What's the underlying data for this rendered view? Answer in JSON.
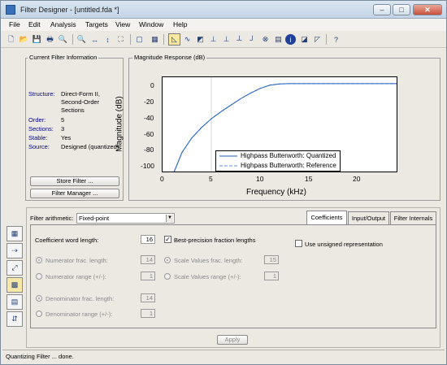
{
  "window": {
    "title": "Filter Designer - [untitled.fda *]",
    "min": "–",
    "max": "□",
    "close": "✕"
  },
  "menu": [
    "File",
    "Edit",
    "Analysis",
    "Targets",
    "View",
    "Window",
    "Help"
  ],
  "toolbar": {
    "items": [
      "new-icon",
      "open-icon",
      "save-icon",
      "print-icon",
      "print-preview-icon",
      "zoom-in-icon",
      "zoom-x-icon",
      "zoom-y-icon",
      "full-view-icon",
      "new-figure-icon",
      "grid-icon",
      "magnitude-response-icon",
      "phase-response-icon",
      "magnitude-phase-icon",
      "group-delay-icon",
      "phase-delay-icon",
      "impulse-response-icon",
      "step-response-icon",
      "pole-zero-icon",
      "coefficients-icon",
      "info-icon",
      "magnitude-estimate-icon",
      "noise-power-icon",
      "whats-this-icon"
    ],
    "glyphs": [
      "🗋",
      "📂",
      "💾",
      "🖶",
      "🔍",
      "🔍",
      "↔",
      "↕",
      "⛶",
      "▢",
      "▦",
      "◺",
      "∿",
      "◩",
      "⊥",
      "⊥",
      "┴",
      "┘",
      "⊗",
      "▤",
      "i",
      "◪",
      "◸",
      "?"
    ]
  },
  "current_filter": {
    "title": "Current Filter Information",
    "rows": [
      {
        "label": "Structure:",
        "value": "Direct-Form II,"
      },
      {
        "label": "",
        "value": "Second-Order"
      },
      {
        "label": "",
        "value": "Sections"
      },
      {
        "label": "Order:",
        "value": "5"
      },
      {
        "label": "Sections:",
        "value": "3"
      },
      {
        "label": "Stable:",
        "value": "Yes"
      },
      {
        "label": "Source:",
        "value": "Designed (quantized)"
      }
    ],
    "store_button": "Store Filter ...",
    "manager_button": "Filter Manager ..."
  },
  "magnitude": {
    "title": "Magnitude Response (dB)",
    "ylabel": "Magnitude (dB)",
    "xlabel": "Frequency (kHz)",
    "yticks": [
      "0",
      "-20",
      "-40",
      "-60",
      "-80",
      "-100"
    ],
    "xticks": [
      "0",
      "5",
      "10",
      "15",
      "20"
    ],
    "legend": [
      "Highpass Butterworth: Quantized",
      "Highpass Butterworth: Reference"
    ]
  },
  "chart_data": {
    "type": "line",
    "title": "Magnitude Response (dB)",
    "xlabel": "Frequency (kHz)",
    "ylabel": "Magnitude (dB)",
    "xlim": [
      0,
      24
    ],
    "ylim": [
      -110,
      8
    ],
    "series": [
      {
        "name": "Highpass Butterworth: Quantized",
        "x": [
          1.2,
          2,
          3,
          4,
          5,
          6,
          7,
          8,
          9,
          10,
          11,
          12,
          13,
          16,
          20,
          24
        ],
        "y": [
          -110,
          -86,
          -68,
          -55,
          -44,
          -35,
          -27,
          -19,
          -12,
          -6,
          -2,
          -0.3,
          0,
          0,
          0,
          0
        ]
      },
      {
        "name": "Highpass Butterworth: Reference",
        "x": [
          1.2,
          2,
          3,
          4,
          5,
          6,
          7,
          8,
          9,
          10,
          11,
          12,
          13,
          16,
          20,
          24
        ],
        "y": [
          -110,
          -86,
          -68,
          -55,
          -44,
          -35,
          -27,
          -19,
          -12,
          -6,
          -2,
          -0.3,
          0,
          0,
          0,
          0
        ]
      }
    ]
  },
  "quant": {
    "arith_label": "Filter arithmetic:",
    "arith_value": "Fixed-point",
    "tabs": [
      "Coefficients",
      "Input/Output",
      "Filter Internals"
    ],
    "coef_word_label": "Coefficient word length:",
    "coef_word_value": "16",
    "best_precision": "Best-precision fraction lengths",
    "unsigned": "Use unsigned representation",
    "num_frac_label": "Numerator frac. length:",
    "num_frac_value": "14",
    "num_range_label": "Numerator range (+/-):",
    "num_range_value": "1",
    "sv_frac_label": "Scale Values frac. length:",
    "sv_frac_value": "15",
    "sv_range_label": "Scale Values range (+/-):",
    "sv_range_value": "1",
    "den_frac_label": "Denominator frac. length:",
    "den_frac_value": "14",
    "den_range_label": "Denominator range (+/-):",
    "den_range_value": "1",
    "apply": "Apply"
  },
  "sidebar": [
    "design-filter-icon",
    "import-filter-icon",
    "transform-filter-icon",
    "quantize-filter-icon",
    "realize-model-icon",
    "multirate-icon"
  ],
  "status": "Quantizing Filter ... done."
}
